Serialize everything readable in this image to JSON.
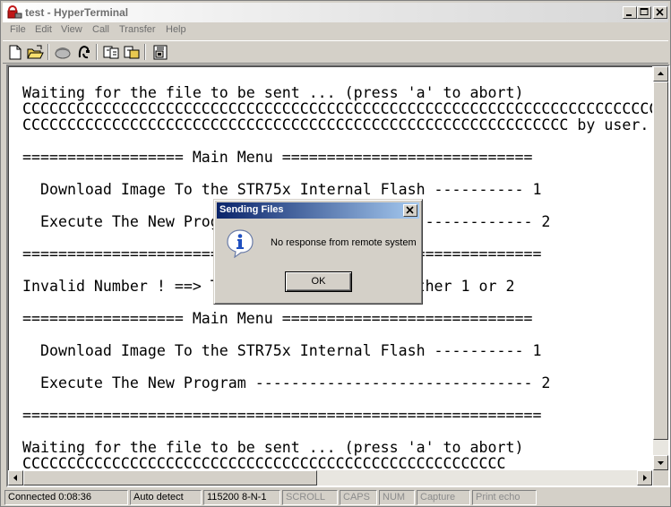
{
  "window": {
    "title": "test - HyperTerminal"
  },
  "menu": [
    "File",
    "Edit",
    "View",
    "Call",
    "Transfer",
    "Help"
  ],
  "toolbar": {
    "icons": [
      "new-icon",
      "open-icon",
      "connect-icon",
      "disconnect-icon",
      "send-icon",
      "receive-icon",
      "properties-icon"
    ]
  },
  "terminal": {
    "lines": [
      "Waiting for the file to be sent ... (press 'a' to abort)",
      "CCCCCCCCCCCCCCCCCCCCCCCCCCCCCCCCCCCCCCCCCCCCCCCCCCCCCCCCCCCCCCCCCCCCCCCCCCC",
      "CCCCCCCCCCCCCCCCCCCCCCCCCCCCCCCCCCCCCCCCCCCCCCCCCCCCCCCCCCCCC by user.",
      "",
      "================== Main Menu ============================",
      "",
      "  Download Image To the STR75x Internal Flash ---------- 1",
      "",
      "  Execute The New Program ------------------------------- 2",
      "",
      "==========================================================",
      "",
      "Invalid Number ! ==> The number should be either 1 or 2",
      "",
      "================== Main Menu ============================",
      "",
      "  Download Image To the STR75x Internal Flash ---------- 1",
      "",
      "  Execute The New Program ------------------------------- 2",
      "",
      "==========================================================",
      "",
      "Waiting for the file to be sent ... (press 'a' to abort)",
      "CCCCCCCCCCCCCCCCCCCCCCCCCCCCCCCCCCCCCCCCCCCCCCCCCCCCCC"
    ]
  },
  "dialog": {
    "title": "Sending Files",
    "message": "No response from remote system",
    "ok_label": "OK",
    "icon": "info-icon"
  },
  "status": {
    "connected": "Connected 0:08:36",
    "detect": "Auto detect",
    "settings": "115200 8-N-1",
    "scroll": "SCROLL",
    "caps": "CAPS",
    "num": "NUM",
    "capture": "Capture",
    "print_echo": "Print echo"
  },
  "colors": {
    "dialog_title_start": "#0a246a",
    "dialog_title_end": "#a6caf0",
    "face": "#d4d0c8"
  }
}
